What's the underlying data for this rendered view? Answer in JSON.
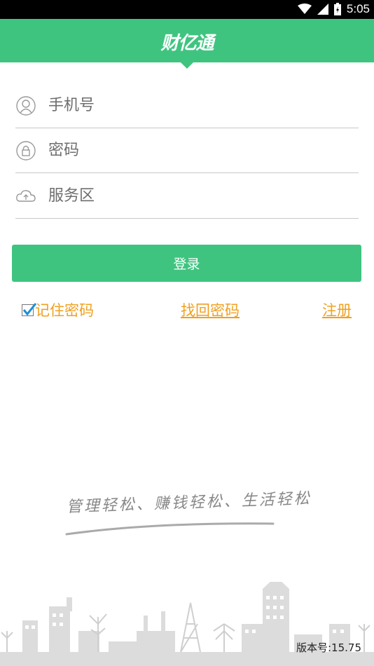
{
  "status_bar": {
    "time": "5:05"
  },
  "header": {
    "logo_text": "财亿通"
  },
  "form": {
    "phone_placeholder": "手机号",
    "password_placeholder": "密码",
    "server_placeholder": "服务区"
  },
  "login_button": "登录",
  "links": {
    "remember_password": "记住密码",
    "remember_checked": true,
    "find_password": "找回密码",
    "register": "注册"
  },
  "slogan": "管理轻松、赚钱轻松、生活轻松",
  "version": "版本号:15.75",
  "colors": {
    "brand": "#3fc480",
    "link": "#f0a020"
  }
}
